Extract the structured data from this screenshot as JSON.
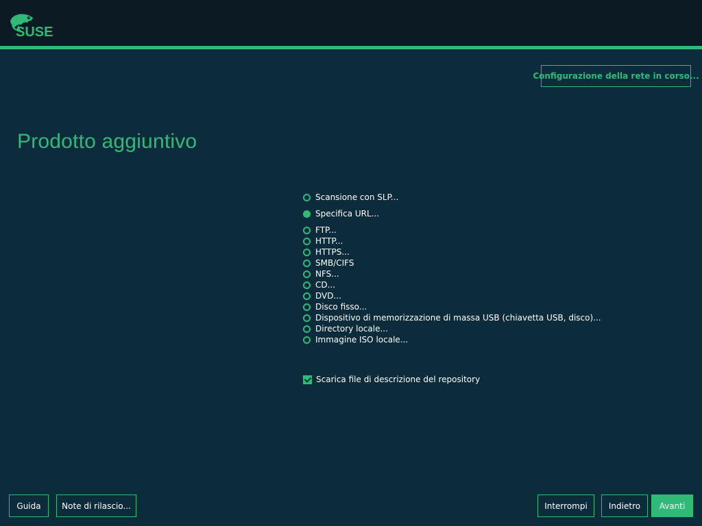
{
  "header": {
    "logo_text": "SUSE"
  },
  "network_button": "Configurazione della rete in corso...",
  "page_title": "Prodotto aggiuntivo",
  "options": [
    {
      "label": "Scansione con SLP...",
      "selected": false
    },
    {
      "label": "Specifica URL...",
      "selected": true
    },
    {
      "label": "FTP...",
      "selected": false
    },
    {
      "label": "HTTP...",
      "selected": false
    },
    {
      "label": "HTTPS...",
      "selected": false
    },
    {
      "label": "SMB/CIFS",
      "selected": false
    },
    {
      "label": "NFS...",
      "selected": false
    },
    {
      "label": "CD...",
      "selected": false
    },
    {
      "label": "DVD...",
      "selected": false
    },
    {
      "label": "Disco fisso...",
      "selected": false
    },
    {
      "label": "Dispositivo di memorizzazione di massa USB (chiavetta USB, disco)...",
      "selected": false
    },
    {
      "label": "Directory locale...",
      "selected": false
    },
    {
      "label": "Immagine ISO locale...",
      "selected": false
    }
  ],
  "download_checkbox": {
    "label": "Scarica file di descrizione del repository",
    "checked": true
  },
  "footer": {
    "help": "Guida",
    "release_notes": "Note di rilascio...",
    "abort": "Interrompi",
    "back": "Indietro",
    "next": "Avanti"
  },
  "colors": {
    "accent": "#30ba78",
    "background": "#0c2c3c",
    "header": "#0b1a23"
  }
}
